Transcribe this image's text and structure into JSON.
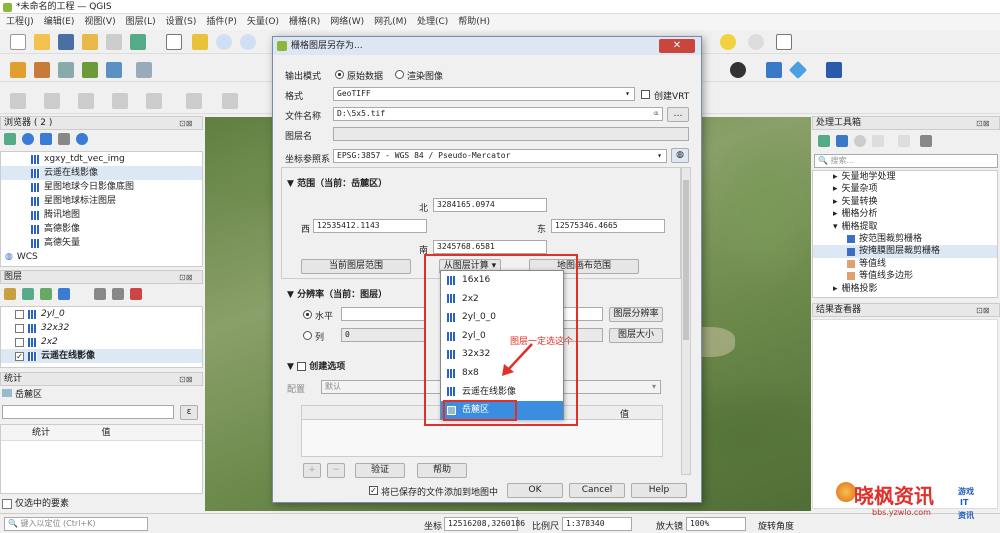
{
  "window": {
    "title": "*未命名的工程 — QGIS"
  },
  "menu": [
    "工程(J)",
    "编辑(E)",
    "视图(V)",
    "图层(L)",
    "设置(S)",
    "插件(P)",
    "矢量(O)",
    "栅格(R)",
    "网络(W)",
    "网孔(M)",
    "处理(C)",
    "帮助(H)"
  ],
  "browser": {
    "title": "浏览器 ( 2 )",
    "items": [
      "xgxy_tdt_vec_img",
      "云遥在线影像",
      "星图地球今日影像底图",
      "星图地球标注图层",
      "腾讯地图",
      "高德影像",
      "高德矢量",
      "WCS"
    ]
  },
  "layers": {
    "title": "图层",
    "items": [
      "2yl_0",
      "32x32",
      "2x2",
      "云遥在线影像"
    ]
  },
  "stats": {
    "title": "统计",
    "layer": "岳麓区",
    "col_stat": "统计",
    "col_value": "值",
    "selected_only": "仅选中的要素"
  },
  "dialog": {
    "title": "栅格图层另存为...",
    "output_mode_label": "输出模式",
    "mode_raw": "原始数据",
    "mode_render": "渲染图像",
    "format_label": "格式",
    "format_value": "GeoTIFF",
    "create_vrt": "创建VRT",
    "filename_label": "文件名称",
    "filename_value": "D:\\5x5.tif",
    "layer_name_label": "图层名",
    "crs_label": "坐标参照系",
    "crs_value": "EPSG:3857 - WGS 84 / Pseudo-Mercator",
    "extent_title": "范围（当前：岳麓区）",
    "north_label": "北",
    "north_value": "3284165.0974",
    "west_label": "西",
    "west_value": "12535412.1143",
    "east_label": "东",
    "east_value": "12575346.4665",
    "south_label": "南",
    "south_value": "3245768.6581",
    "btn_current_extent": "当前图层范围",
    "btn_calc_from_layer": "从图层计算",
    "btn_map_canvas": "地图画布范围",
    "resolution_title": "分辨率（当前：图层）",
    "horiz_label": "水平",
    "col_label": "列",
    "col_value": "0",
    "btn_layer_res": "图层分辨率",
    "btn_layer_size": "图层大小",
    "create_options": "创建选项",
    "profile_label": "配置",
    "profile_value": "默认",
    "table_col_value": "值",
    "btn_validate": "验证",
    "btn_help2": "帮助",
    "add_to_map": "将已保存的文件添加到地图中",
    "ok": "OK",
    "cancel": "Cancel",
    "help": "Help"
  },
  "dropdown": {
    "items": [
      "16x16",
      "2x2",
      "2yl_0_0",
      "2yl_0",
      "32x32",
      "8x8",
      "云遥在线影像",
      "岳麓区"
    ],
    "selected": "岳麓区"
  },
  "annotation": "图层一定选这个",
  "toolbox": {
    "title": "处理工具箱",
    "search_placeholder": "搜索...",
    "items": [
      "矢量地学处理",
      "矢量杂项",
      "矢量转换",
      "栅格分析",
      "栅格提取",
      "按范围裁剪栅格",
      "按掩膜图层裁剪栅格",
      "等值线",
      "等值线多边形",
      "栅格投影"
    ]
  },
  "results": {
    "title": "结果查看器"
  },
  "status": {
    "locate_placeholder": "键入以定位 (Ctrl+K)",
    "coord_label": "坐标",
    "coord_value": "12516208,3260186",
    "scale_label": "比例尺",
    "scale_value": "1:378340",
    "magnifier_label": "放大镜",
    "magnifier_value": "100%",
    "rotation_label": "旋转角度"
  },
  "watermark": {
    "brand": "晓枫资讯",
    "url": "bbs.yzwlo.com",
    "tag1": "游戏",
    "tag2": "IT",
    "tag3": "资讯"
  }
}
